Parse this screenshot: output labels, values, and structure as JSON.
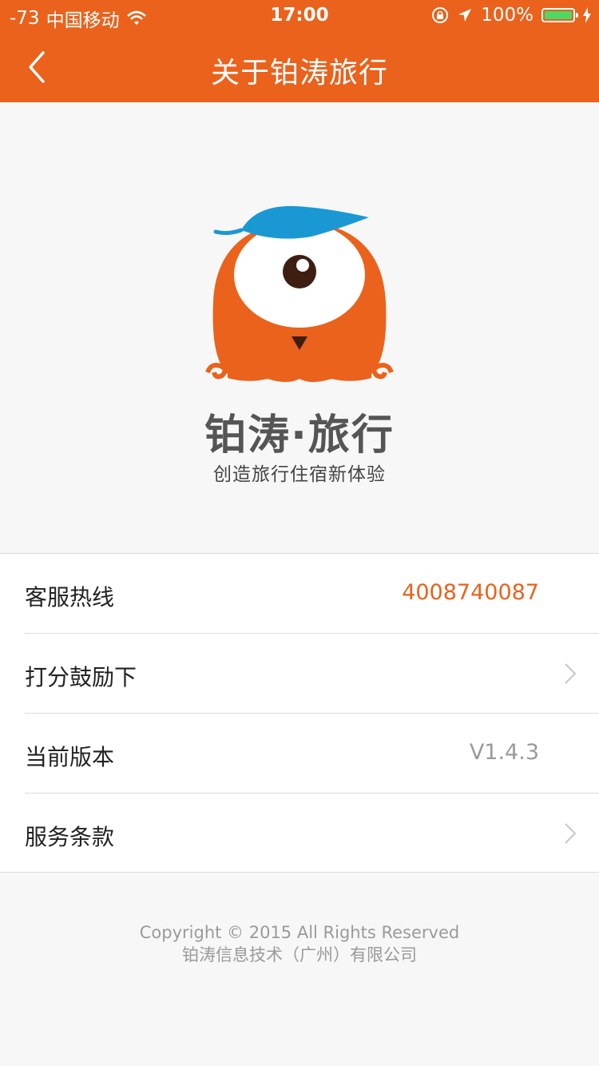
{
  "status_bar": {
    "signal": "-73",
    "carrier": "中国移动",
    "time": "17:00",
    "battery": "100%"
  },
  "nav": {
    "title": "关于铂涛旅行"
  },
  "brand": {
    "name": "铂涛·旅行",
    "slogan": "创造旅行住宿新体验"
  },
  "list": {
    "hotline": {
      "label": "客服热线",
      "value": "4008740087"
    },
    "rate": {
      "label": "打分鼓励下"
    },
    "version": {
      "label": "当前版本",
      "value": "V1.4.3"
    },
    "terms": {
      "label": "服务条款"
    }
  },
  "footer": {
    "copyright": "Copyright © 2015  All  Rights  Reserved",
    "company": "铂涛信息技术（广州）有限公司"
  },
  "colors": {
    "accent": "#ea621c",
    "leaf": "#1a98d4"
  }
}
